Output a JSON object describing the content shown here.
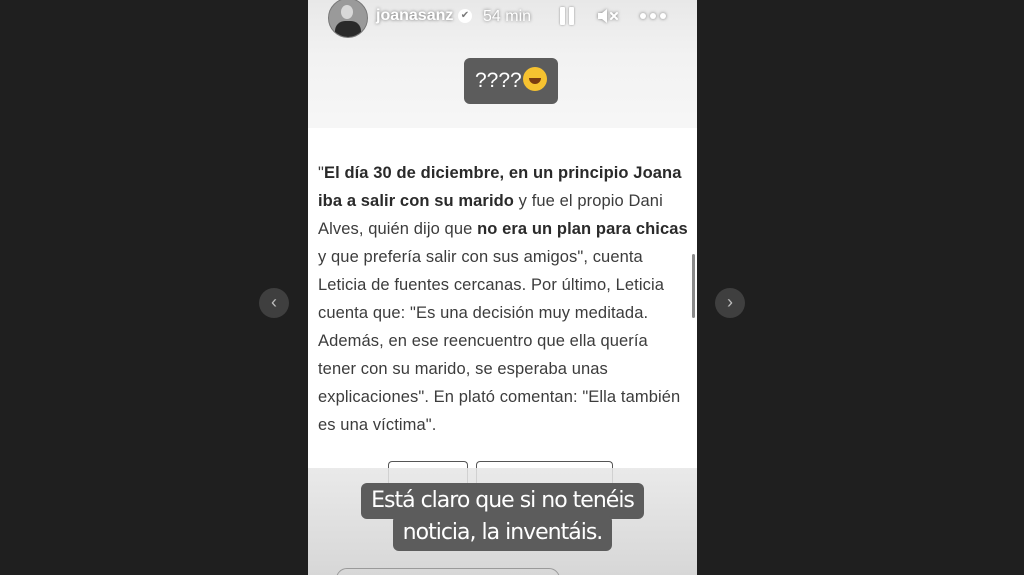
{
  "header": {
    "username": "joanasanz",
    "verified_glyph": "✔",
    "time_ago": "54 min",
    "icons": [
      "pause-icon",
      "mute-icon",
      "more-options-icon"
    ]
  },
  "stickers": {
    "top": "????",
    "top_emoji": "rolling-on-floor-laughing-emoji",
    "bottom_line1": "Está claro que si no tenéis",
    "bottom_line2": "noticia, la inventáis."
  },
  "article": {
    "p1": "\"",
    "b1": "El día 30 de diciembre, en un principio Joana iba a salir con su marido",
    "p2": " y fue el propio Dani Alves, quién dijo que ",
    "b2": "no era un plan para chicas",
    "p3": " y que prefería salir con sus amigos\", cuenta Leticia de fuentes cercanas. Por último, Leticia cuenta que: \"Es una decisión muy meditada. Además, en ese reencuentro que ella quería tener con su marido, se esperaba unas explicaciones\". En plató comentan: \"Ella también es una víctima\"."
  },
  "nav": {
    "prev_glyph": "‹",
    "next_glyph": "›"
  },
  "colors": {
    "background": "#1f1f1f",
    "sticker": "#5c5c5c"
  }
}
